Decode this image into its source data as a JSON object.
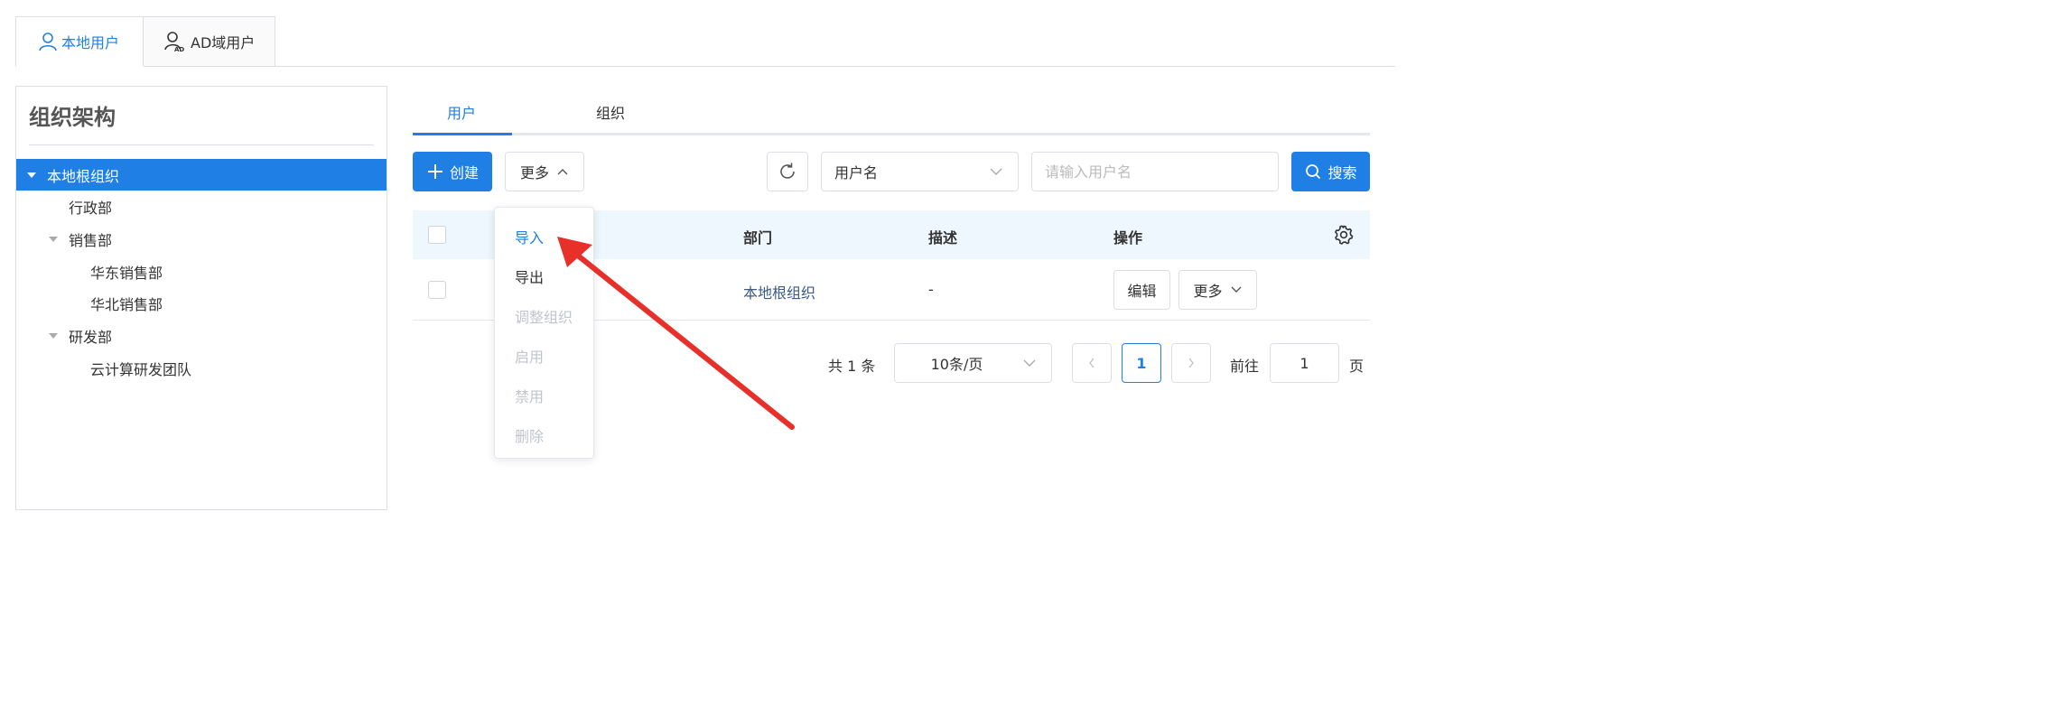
{
  "top_tabs": [
    {
      "label": "本地用户",
      "icon": "user-icon",
      "active": true
    },
    {
      "label": "AD域用户",
      "icon": "ad-user-icon",
      "active": false
    }
  ],
  "ad_badge": "AD",
  "left_panel": {
    "title": "组织架构",
    "tree": [
      {
        "label": "本地根组织",
        "level": 0,
        "expanded": true,
        "selected": true
      },
      {
        "label": "行政部",
        "level": 1
      },
      {
        "label": "销售部",
        "level": 1,
        "expanded": true
      },
      {
        "label": "华东销售部",
        "level": 2
      },
      {
        "label": "华北销售部",
        "level": 2
      },
      {
        "label": "研发部",
        "level": 1,
        "expanded": true
      },
      {
        "label": "云计算研发团队",
        "level": 2
      }
    ]
  },
  "inner_tabs": [
    {
      "label": "用户",
      "active": true
    },
    {
      "label": "组织",
      "active": false
    }
  ],
  "toolbar": {
    "create_label": "创建",
    "more_label": "更多",
    "filter_select": "用户名",
    "search_placeholder": "请输入用户名",
    "search_label": "搜索"
  },
  "table": {
    "columns": [
      "部门",
      "描述",
      "操作"
    ],
    "rows": [
      {
        "department": "本地根组织",
        "description": "-",
        "edit_label": "编辑",
        "more_label": "更多"
      }
    ]
  },
  "pagination": {
    "total_label": "共 1 条",
    "page_size": "10条/页",
    "current_page": "1",
    "goto_label": "前往",
    "goto_value": "1",
    "page_suffix": "页"
  },
  "more_menu": [
    {
      "label": "导入",
      "state": "active"
    },
    {
      "label": "导出",
      "state": "enabled"
    },
    {
      "label": "调整组织",
      "state": "disabled"
    },
    {
      "label": "启用",
      "state": "disabled"
    },
    {
      "label": "禁用",
      "state": "disabled"
    },
    {
      "label": "删除",
      "state": "disabled"
    }
  ],
  "colors": {
    "primary": "#1f7fe5",
    "annotation_arrow": "#e8302a",
    "table_header_bg": "#eef6fe",
    "disabled_text": "#c0c4cc"
  }
}
